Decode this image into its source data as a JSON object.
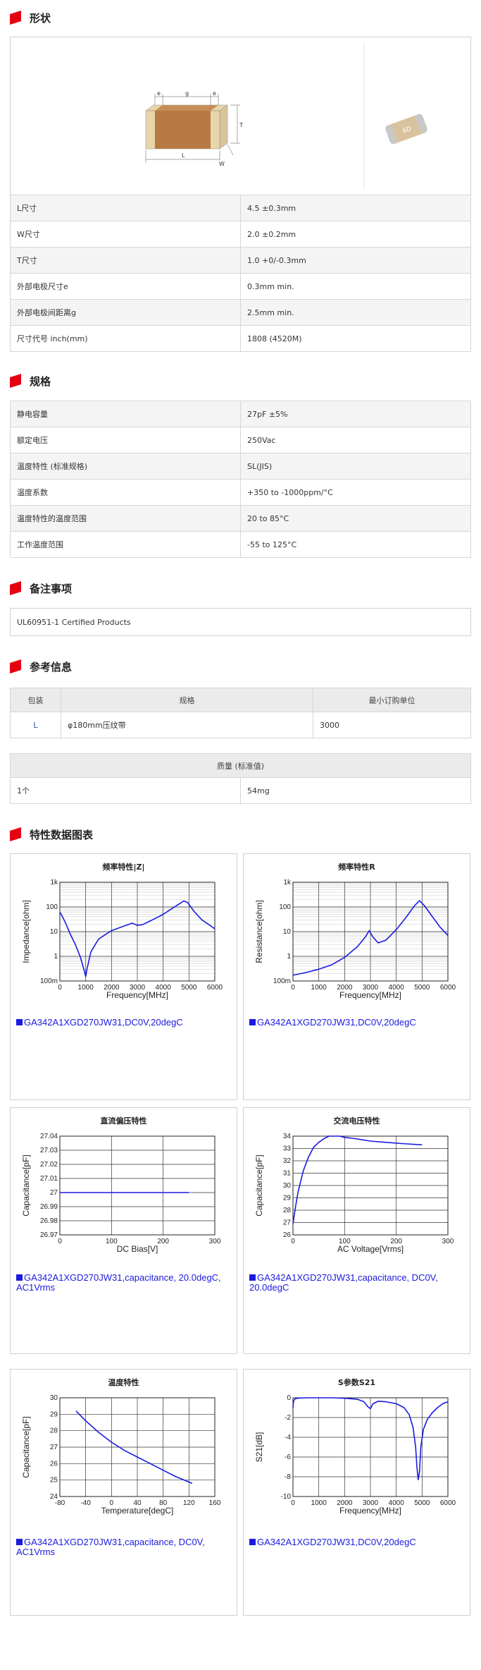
{
  "sections": {
    "shape": "形状",
    "spec": "规格",
    "notes": "备注事项",
    "ref": "参考信息",
    "charts": "特性数据图表"
  },
  "shape_labels": {
    "e1": "e",
    "g": "g",
    "e2": "e",
    "T": "T",
    "W": "W",
    "L": "L",
    "chip_mark": "6D"
  },
  "dimensions": [
    {
      "k": "L尺寸",
      "v": "4.5 ±0.3mm"
    },
    {
      "k": "W尺寸",
      "v": "2.0 ±0.2mm"
    },
    {
      "k": "T尺寸",
      "v": "1.0 +0/-0.3mm"
    },
    {
      "k": "外部电极尺寸e",
      "v": "0.3mm min."
    },
    {
      "k": "外部电极间距离g",
      "v": "2.5mm min."
    },
    {
      "k": "尺寸代号 inch(mm)",
      "v": "1808 (4520M)"
    }
  ],
  "specs": [
    {
      "k": "静电容量",
      "v": "27pF ±5%"
    },
    {
      "k": "额定电压",
      "v": "250Vac"
    },
    {
      "k": "温度特性 (标准规格)",
      "v": "SL(JIS)"
    },
    {
      "k": "温度系数",
      "v": "+350 to -1000ppm/°C"
    },
    {
      "k": "温度特性的温度范围",
      "v": "20 to 85°C"
    },
    {
      "k": "工作温度范围",
      "v": "-55 to 125°C"
    }
  ],
  "notes": "UL60951-1 Certified Products",
  "packaging": {
    "headers": [
      "包装",
      "规格",
      "最小订购单位"
    ],
    "row": [
      "L",
      "φ180mm压纹带",
      "3000"
    ]
  },
  "mass": {
    "header": "质量 (标准值)",
    "row": [
      "1个",
      "54mg"
    ]
  },
  "chart_data": [
    {
      "type": "line",
      "title": "频率特性|Z|",
      "xlabel": "Frequency[MHz]",
      "ylabel": "Impedance[ohm]",
      "xlim": [
        0,
        6000
      ],
      "log_y": true,
      "ylim": [
        0.1,
        1000
      ],
      "xticks": [
        "0",
        "1000",
        "2000",
        "3000",
        "4000",
        "5000",
        "6000"
      ],
      "yticks": [
        "100m",
        "1",
        "10",
        "100",
        "1k"
      ],
      "series": [
        {
          "x": [
            10,
            100,
            200,
            400,
            600,
            800,
            950,
            1000,
            1050,
            1200,
            1500,
            2000,
            2500,
            2800,
            3000,
            3200,
            3500,
            4000,
            4500,
            4800,
            4950,
            5200,
            5500,
            6000
          ],
          "y": [
            60,
            40,
            25,
            8,
            3,
            0.9,
            0.25,
            0.15,
            0.3,
            1.5,
            5,
            11,
            17,
            22,
            18,
            19,
            27,
            50,
            110,
            175,
            150,
            65,
            30,
            13
          ]
        }
      ],
      "legend": "GA342A1XGD270JW31,DC0V,20degC"
    },
    {
      "type": "line",
      "title": "频率特性R",
      "xlabel": "Frequency[MHz]",
      "ylabel": "Resistance[ohm]",
      "xlim": [
        0,
        6000
      ],
      "log_y": true,
      "ylim": [
        0.1,
        1000
      ],
      "xticks": [
        "0",
        "1000",
        "2000",
        "3000",
        "4000",
        "5000",
        "6000"
      ],
      "yticks": [
        "100m",
        "1",
        "10",
        "100",
        "1k"
      ],
      "series": [
        {
          "x": [
            0,
            500,
            1000,
            1500,
            2000,
            2500,
            2800,
            2950,
            3100,
            3300,
            3600,
            4000,
            4400,
            4700,
            4900,
            5100,
            5400,
            5700,
            6000
          ],
          "y": [
            0.17,
            0.22,
            0.3,
            0.45,
            0.9,
            2.5,
            6,
            11,
            6,
            3.5,
            4.5,
            12,
            40,
            110,
            180,
            110,
            40,
            15,
            7
          ]
        }
      ],
      "legend": "GA342A1XGD270JW31,DC0V,20degC"
    },
    {
      "type": "line",
      "title": "直流偏压特性",
      "xlabel": "DC Bias[V]",
      "ylabel": "Capacitance[pF]",
      "xlim": [
        0,
        300
      ],
      "ylim": [
        26.97,
        27.04
      ],
      "xticks": [
        "0",
        "100",
        "200",
        "300"
      ],
      "yticks": [
        "26.97",
        "26.98",
        "26.99",
        "27",
        "27.01",
        "27.02",
        "27.03",
        "27.04"
      ],
      "series": [
        {
          "x": [
            0,
            50,
            100,
            150,
            200,
            250
          ],
          "y": [
            27,
            27,
            27,
            27,
            27,
            27
          ]
        }
      ],
      "legend": "GA342A1XGD270JW31,capacitance, 20.0degC, AC1Vrms"
    },
    {
      "type": "line",
      "title": "交流电压特性",
      "xlabel": "AC Voltage[Vrms]",
      "ylabel": "Capacitance[pF]",
      "xlim": [
        0,
        300
      ],
      "ylim": [
        26,
        34
      ],
      "xticks": [
        "0",
        "100",
        "200",
        "300"
      ],
      "yticks": [
        "26",
        "27",
        "28",
        "29",
        "30",
        "31",
        "32",
        "33",
        "34"
      ],
      "series": [
        {
          "x": [
            0,
            5,
            10,
            20,
            30,
            40,
            50,
            60,
            70,
            80,
            90,
            100,
            120,
            150,
            180,
            210,
            250
          ],
          "y": [
            26.9,
            28.3,
            29.5,
            31.2,
            32.3,
            33.1,
            33.5,
            33.8,
            34,
            34,
            34,
            33.9,
            33.8,
            33.6,
            33.5,
            33.4,
            33.3
          ]
        }
      ],
      "legend": "GA342A1XGD270JW31,capacitance, DC0V, 20.0degC"
    },
    {
      "type": "line",
      "title": "温度特性",
      "xlabel": "Temperature[degC]",
      "ylabel": "Capacitance[pF]",
      "xlim": [
        -80,
        160
      ],
      "ylim": [
        24,
        30
      ],
      "xticks": [
        "-80",
        "-40",
        "0",
        "40",
        "80",
        "120",
        "160"
      ],
      "yticks": [
        "24",
        "25",
        "26",
        "27",
        "28",
        "29",
        "30"
      ],
      "series": [
        {
          "x": [
            -55,
            -40,
            -20,
            0,
            20,
            40,
            60,
            80,
            100,
            125
          ],
          "y": [
            29.2,
            28.6,
            27.9,
            27.3,
            26.8,
            26.4,
            26,
            25.6,
            25.2,
            24.8
          ]
        }
      ],
      "legend": "GA342A1XGD270JW31,capacitance, DC0V, AC1Vrms"
    },
    {
      "type": "line",
      "title": "S参数S21",
      "xlabel": "Frequency[MHz]",
      "ylabel": "S21[dB]",
      "xlim": [
        0,
        6000
      ],
      "ylim": [
        -10,
        0
      ],
      "xticks": [
        "0",
        "1000",
        "2000",
        "3000",
        "4000",
        "5000",
        "6000"
      ],
      "yticks": [
        "-10",
        "-8",
        "-6",
        "-4",
        "-2",
        "0"
      ],
      "series": [
        {
          "x": [
            0,
            20,
            60,
            150,
            300,
            600,
            1000,
            1500,
            2000,
            2500,
            2750,
            2900,
            3000,
            3100,
            3300,
            3600,
            4000,
            4300,
            4500,
            4650,
            4750,
            4800,
            4850,
            4900,
            4950,
            5050,
            5200,
            5400,
            5600,
            5800,
            6000
          ],
          "y": [
            -1,
            -0.4,
            -0.15,
            -0.05,
            -0.02,
            0,
            0,
            0,
            -0.05,
            -0.15,
            -0.4,
            -0.9,
            -1.1,
            -0.6,
            -0.35,
            -0.4,
            -0.6,
            -1,
            -1.7,
            -3,
            -5,
            -7,
            -8.3,
            -7.5,
            -5,
            -3.2,
            -2.2,
            -1.5,
            -1,
            -0.6,
            -0.4
          ]
        }
      ],
      "legend": "GA342A1XGD270JW31,DC0V,20degC"
    }
  ]
}
